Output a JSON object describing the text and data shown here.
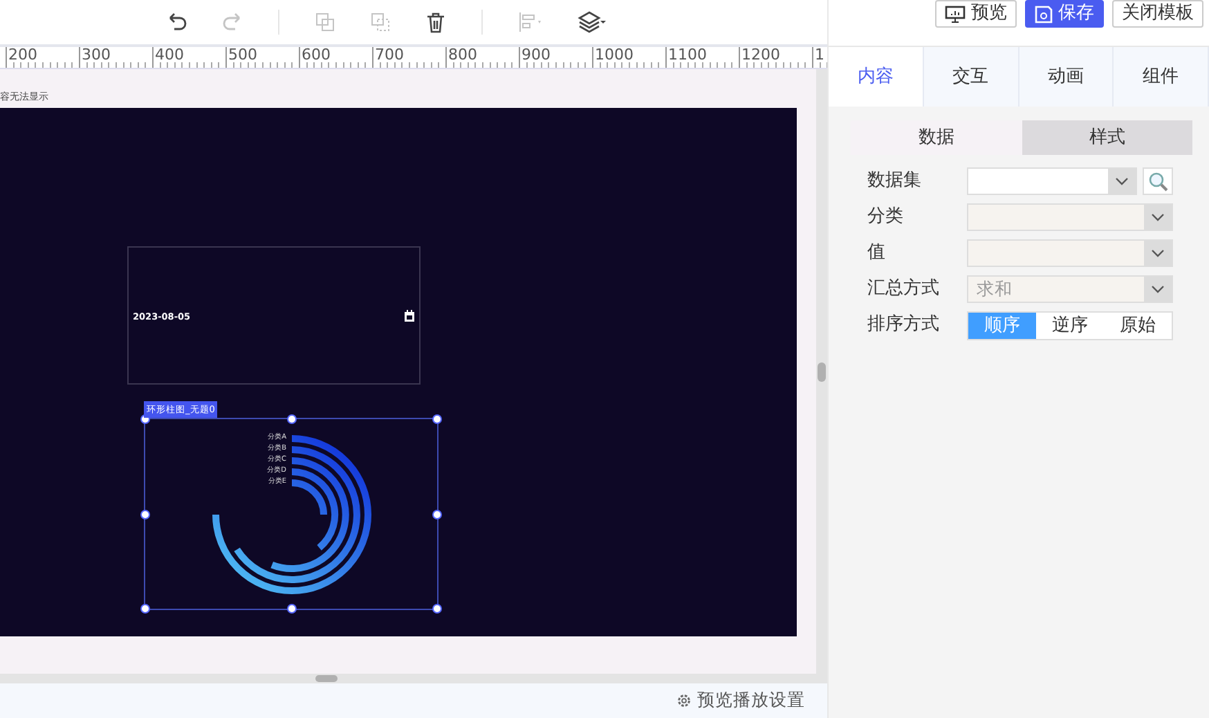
{
  "toolbar": {
    "tools": [
      {
        "kind": "undo",
        "disabled": false
      },
      {
        "kind": "redo",
        "disabled": true
      },
      {
        "kind": "copy",
        "disabled": true
      },
      {
        "kind": "paste",
        "disabled": true
      },
      {
        "kind": "delete",
        "disabled": false
      },
      {
        "kind": "align",
        "disabled": true
      },
      {
        "kind": "layers",
        "disabled": false
      }
    ]
  },
  "header_buttons": [
    {
      "label": "预览",
      "kind": "preview",
      "primary": false
    },
    {
      "label": "保存",
      "kind": "save",
      "primary": true
    },
    {
      "label": "关闭模板",
      "kind": "close",
      "primary": false
    }
  ],
  "ruler": [
    "200",
    "300",
    "400",
    "500",
    "600",
    "700",
    "800",
    "900",
    "1000",
    "1100",
    "1200",
    "1"
  ],
  "canvas": {
    "note": "容无法显示",
    "date_widget": {
      "date": "2023-08-05"
    },
    "chart_widget": {
      "tag": "环形柱图_无题0",
      "selected": true,
      "series": [
        {
          "label": "分类A"
        },
        {
          "label": "分类B"
        },
        {
          "label": "分类C"
        },
        {
          "label": "分类D"
        },
        {
          "label": "分类E"
        }
      ]
    }
  },
  "footer": {
    "settings": "预览播放设置"
  },
  "panel": {
    "tabs": [
      {
        "label": "内容",
        "selected": true
      },
      {
        "label": "交互",
        "selected": false
      },
      {
        "label": "动画",
        "selected": false
      },
      {
        "label": "组件",
        "selected": false
      }
    ],
    "subtabs": [
      {
        "label": "数据",
        "selected": true
      },
      {
        "label": "样式",
        "selected": false
      }
    ],
    "fields": [
      {
        "label": "数据集",
        "kind": "search-select",
        "disabled": false
      },
      {
        "label": "分类",
        "kind": "select",
        "disabled": true
      },
      {
        "label": "值",
        "kind": "select",
        "disabled": true
      },
      {
        "label": "汇总方式",
        "kind": "select",
        "disabled": true,
        "value": "求和"
      },
      {
        "label": "排序方式",
        "kind": "segmented",
        "options": [
          {
            "label": "顺序",
            "selected": true
          },
          {
            "label": "逆序",
            "selected": false
          },
          {
            "label": "原始",
            "selected": false
          }
        ]
      }
    ]
  }
}
